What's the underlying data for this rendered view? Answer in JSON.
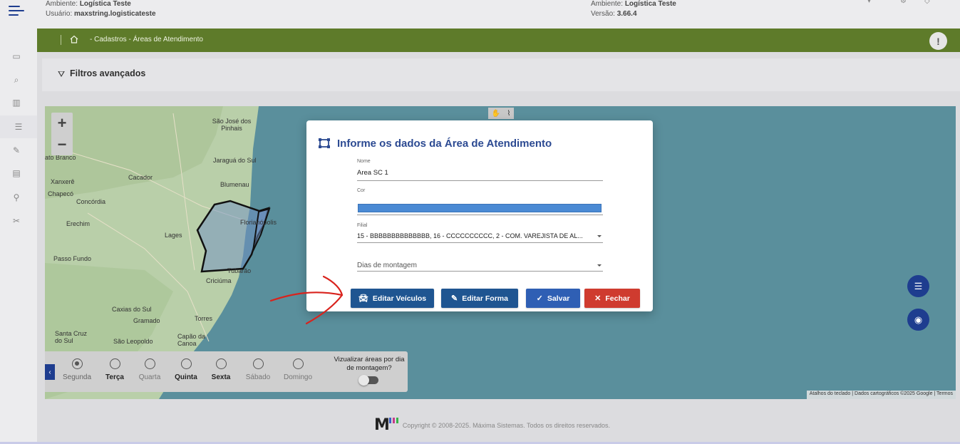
{
  "header": {
    "left_env_label": "Ambiente:",
    "left_env_value": "Logística Teste",
    "user_label": "Usuário:",
    "user_value": "maxstring.logisticateste",
    "right_env_label": "Ambiente:",
    "right_env_value": "Logística Teste",
    "version_label": "Versão:",
    "version_value": "3.66.4"
  },
  "breadcrumb": {
    "text": "- Cadastros - Áreas de Atendimento"
  },
  "filters": {
    "label": "Filtros avançados"
  },
  "map": {
    "zoom_in": "+",
    "zoom_out": "−",
    "attribution": "Atalhos do teclado  |  Dados cartográficos ©2025 Google  |  Termos",
    "labels": [
      {
        "text": "São José dos Pinhais"
      },
      {
        "text": "Jaraguá do Sul"
      },
      {
        "text": "Blumenau"
      },
      {
        "text": "Florianópolis"
      },
      {
        "text": "Cacador"
      },
      {
        "text": "Chapecó"
      },
      {
        "text": "Xanxerê"
      },
      {
        "text": "Concórdia"
      },
      {
        "text": "Erechim"
      },
      {
        "text": "Lages"
      },
      {
        "text": "Passo Fundo"
      },
      {
        "text": "Tubarão"
      },
      {
        "text": "Criciúma"
      },
      {
        "text": "Caxias do Sul"
      },
      {
        "text": "Gramado"
      },
      {
        "text": "Torres"
      },
      {
        "text": "Santa Cruz do Sul"
      },
      {
        "text": "São Leopoldo"
      },
      {
        "text": "Capão da Canoa"
      },
      {
        "text": "ato Branco"
      }
    ]
  },
  "days_panel": {
    "collapse": "‹",
    "days": [
      {
        "label": "Segunda",
        "selected": true,
        "style": "normal"
      },
      {
        "label": "Terça",
        "selected": false,
        "style": "bold"
      },
      {
        "label": "Quarta",
        "selected": false,
        "style": "light"
      },
      {
        "label": "Quinta",
        "selected": false,
        "style": "bold"
      },
      {
        "label": "Sexta",
        "selected": false,
        "style": "bold"
      },
      {
        "label": "Sábado",
        "selected": false,
        "style": "light"
      },
      {
        "label": "Domingo",
        "selected": false,
        "style": "light"
      }
    ],
    "visualize_label": "Vizualizar áreas por dia de montagem?"
  },
  "modal": {
    "title": "Informe os dados da Área de Atendimento",
    "nome_label": "Nome",
    "nome_value": "Area SC 1",
    "cor_label": "Cor",
    "cor_value": "#4a8ad4",
    "filial_label": "Filial",
    "filial_value": "15 - BBBBBBBBBBBBBB, 16 - CCCCCCCCCC, 2 - COM. VAREJISTA DE AL...",
    "dias_placeholder": "Dias de montagem",
    "btn_editar_veiculos": "Editar Veículos",
    "btn_editar_forma": "Editar Forma",
    "btn_salvar": "Salvar",
    "btn_fechar": "Fechar"
  },
  "footer": {
    "logo": "M",
    "copyright": "Copyright © 2008-2025. Máxima Sistemas. Todos os direitos reservados."
  },
  "colors": {
    "brand_blue": "#1e3d8f",
    "green_bar": "#5e7b2a",
    "danger": "#cf3b2f",
    "ocean": "#5a8f9c"
  }
}
